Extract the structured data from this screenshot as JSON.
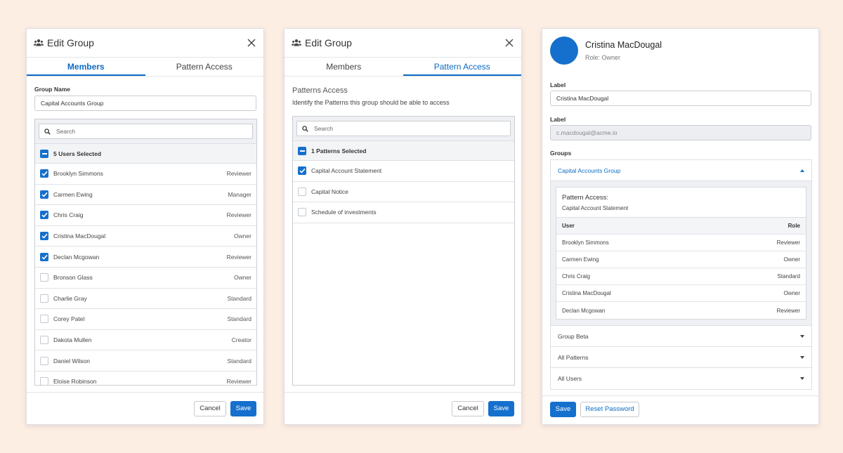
{
  "colors": {
    "background": "#fdeee4",
    "accent": "#1570cd",
    "link": "#0b6bc4"
  },
  "panel1": {
    "title": "Edit Group",
    "tabs": [
      {
        "label": "Members",
        "active": true
      },
      {
        "label": "Pattern Access",
        "active": false
      }
    ],
    "group_name_label": "Group Name",
    "group_name_value": "Capital Accounts Group",
    "search_placeholder": "Search",
    "selected_summary": "5 Users Selected",
    "users": [
      {
        "name": "Brooklyn Simmons",
        "role": "Reviewer",
        "checked": true
      },
      {
        "name": "Carmen Ewing",
        "role": "Manager",
        "checked": true
      },
      {
        "name": "Chris Craig",
        "role": "Reviewer",
        "checked": true
      },
      {
        "name": "Cristina MacDougal",
        "role": "Owner",
        "checked": true
      },
      {
        "name": "Declan Mcgowan",
        "role": "Reviewer",
        "checked": true
      },
      {
        "name": "Bronson Glass",
        "role": "Owner",
        "checked": false
      },
      {
        "name": "Charlie Gray",
        "role": "Standard",
        "checked": false
      },
      {
        "name": "Corey Patel",
        "role": "Standard",
        "checked": false
      },
      {
        "name": "Dakota Mullen",
        "role": "Creator",
        "checked": false
      },
      {
        "name": "Daniel Wilson",
        "role": "Standard",
        "checked": false
      },
      {
        "name": "Eloise Robinson",
        "role": "Reviewer",
        "checked": false
      }
    ],
    "cancel_label": "Cancel",
    "save_label": "Save"
  },
  "panel2": {
    "title": "Edit Group",
    "tabs": [
      {
        "label": "Members",
        "active": false
      },
      {
        "label": "Pattern Access",
        "active": true
      }
    ],
    "section_title": "Patterns Access",
    "section_description": "Identify the Patterns this group should be able to access",
    "search_placeholder": "Search",
    "selected_summary": "1 Patterns Selected",
    "patterns": [
      {
        "name": "Capital Account Statement",
        "checked": true
      },
      {
        "name": "Capital Notice",
        "checked": false
      },
      {
        "name": "Schedule of investments",
        "checked": false
      }
    ],
    "cancel_label": "Cancel",
    "save_label": "Save"
  },
  "panel3": {
    "name": "Cristina MacDougal",
    "role": "Role: Owner",
    "label1": "Label",
    "label1_value": "Cristina MacDougal",
    "label2": "Label",
    "label2_value": "c.macdougal@acme.io",
    "groups_label": "Groups",
    "expanded_group": {
      "name": "Capital Accounts Group",
      "pattern_access_label": "Pattern Access:",
      "pattern_access_value": "Capital Account Statement",
      "col_user": "User",
      "col_role": "Role",
      "rows": [
        {
          "user": "Brooklyn Simmons",
          "role": "Reviewer"
        },
        {
          "user": "Carmen Ewing",
          "role": "Owner"
        },
        {
          "user": "Chris Craig",
          "role": "Standard"
        },
        {
          "user": "Cristina MacDougal",
          "role": "Owner"
        },
        {
          "user": "Declan Mcgowan",
          "role": "Reviewer"
        }
      ]
    },
    "collapsed_groups": [
      "Group Beta",
      "All Patterns",
      "All Users"
    ],
    "save_label": "Save",
    "reset_label": "Reset Password"
  }
}
